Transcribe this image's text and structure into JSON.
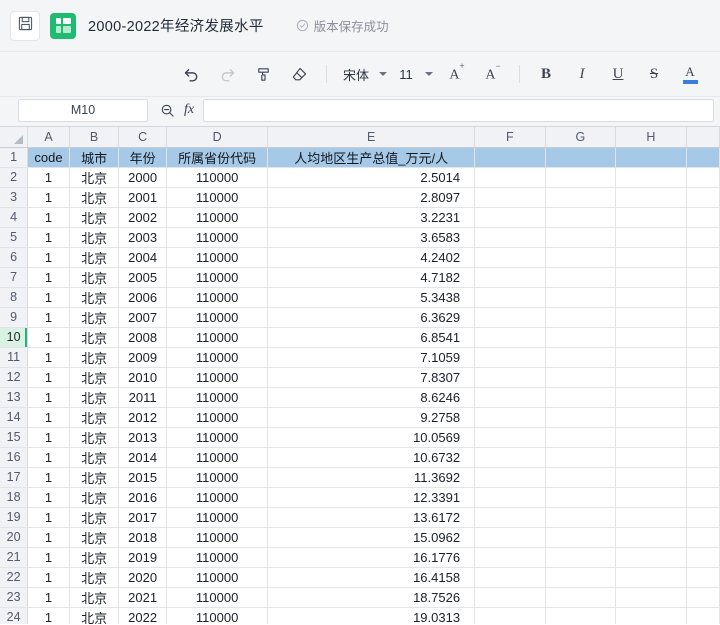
{
  "titlebar": {
    "save_icon": "floppy-disk-icon",
    "app_icon": "spreadsheet-app-icon",
    "doc_title": "2000-2022年经济发展水平",
    "save_status_icon": "check-circle-icon",
    "save_status": "版本保存成功"
  },
  "toolbar": {
    "undo": "↰",
    "redo": "↱",
    "format_painter": "format-painter-icon",
    "clear_format": "eraser-icon",
    "font_name": "宋体",
    "font_size": "11",
    "increase_font": "A",
    "increase_font_sup": "+",
    "decrease_font": "A",
    "decrease_font_sup": "−",
    "bold": "B",
    "italic": "I",
    "underline": "U",
    "strikethrough": "S",
    "font_color": "A",
    "font_color_hex": "#3b7ddd"
  },
  "formula_bar": {
    "name_box_value": "M10",
    "zoom_icon": "zoom-out-icon",
    "fx_label": "fx",
    "formula_value": "",
    "formula_placeholder": ""
  },
  "grid": {
    "column_headers": [
      "A",
      "B",
      "C",
      "D",
      "E",
      "F",
      "G",
      "H"
    ],
    "header_row_index": "1",
    "active_row": "10",
    "header_fill_hex": "#a6c9e8",
    "active_row_fill_hex": "#d9f2e4",
    "columns": [
      "code",
      "城市",
      "年份",
      "所属省份代码",
      "人均地区生产总值_万元/人"
    ],
    "rows": [
      {
        "n": "1",
        "a": "code",
        "b": "城市",
        "c": "年份",
        "d": "所属省份代码",
        "e": "人均地区生产总值_万元/人",
        "header": true
      },
      {
        "n": "2",
        "a": "1",
        "b": "北京",
        "c": "2000",
        "d": "110000",
        "e": "2.5014"
      },
      {
        "n": "3",
        "a": "1",
        "b": "北京",
        "c": "2001",
        "d": "110000",
        "e": "2.8097"
      },
      {
        "n": "4",
        "a": "1",
        "b": "北京",
        "c": "2002",
        "d": "110000",
        "e": "3.2231"
      },
      {
        "n": "5",
        "a": "1",
        "b": "北京",
        "c": "2003",
        "d": "110000",
        "e": "3.6583"
      },
      {
        "n": "6",
        "a": "1",
        "b": "北京",
        "c": "2004",
        "d": "110000",
        "e": "4.2402"
      },
      {
        "n": "7",
        "a": "1",
        "b": "北京",
        "c": "2005",
        "d": "110000",
        "e": "4.7182"
      },
      {
        "n": "8",
        "a": "1",
        "b": "北京",
        "c": "2006",
        "d": "110000",
        "e": "5.3438"
      },
      {
        "n": "9",
        "a": "1",
        "b": "北京",
        "c": "2007",
        "d": "110000",
        "e": "6.3629"
      },
      {
        "n": "10",
        "a": "1",
        "b": "北京",
        "c": "2008",
        "d": "110000",
        "e": "6.8541",
        "active": true
      },
      {
        "n": "11",
        "a": "1",
        "b": "北京",
        "c": "2009",
        "d": "110000",
        "e": "7.1059"
      },
      {
        "n": "12",
        "a": "1",
        "b": "北京",
        "c": "2010",
        "d": "110000",
        "e": "7.8307"
      },
      {
        "n": "13",
        "a": "1",
        "b": "北京",
        "c": "2011",
        "d": "110000",
        "e": "8.6246"
      },
      {
        "n": "14",
        "a": "1",
        "b": "北京",
        "c": "2012",
        "d": "110000",
        "e": "9.2758"
      },
      {
        "n": "15",
        "a": "1",
        "b": "北京",
        "c": "2013",
        "d": "110000",
        "e": "10.0569"
      },
      {
        "n": "16",
        "a": "1",
        "b": "北京",
        "c": "2014",
        "d": "110000",
        "e": "10.6732"
      },
      {
        "n": "17",
        "a": "1",
        "b": "北京",
        "c": "2015",
        "d": "110000",
        "e": "11.3692"
      },
      {
        "n": "18",
        "a": "1",
        "b": "北京",
        "c": "2016",
        "d": "110000",
        "e": "12.3391"
      },
      {
        "n": "19",
        "a": "1",
        "b": "北京",
        "c": "2017",
        "d": "110000",
        "e": "13.6172"
      },
      {
        "n": "20",
        "a": "1",
        "b": "北京",
        "c": "2018",
        "d": "110000",
        "e": "15.0962"
      },
      {
        "n": "21",
        "a": "1",
        "b": "北京",
        "c": "2019",
        "d": "110000",
        "e": "16.1776"
      },
      {
        "n": "22",
        "a": "1",
        "b": "北京",
        "c": "2020",
        "d": "110000",
        "e": "16.4158"
      },
      {
        "n": "23",
        "a": "1",
        "b": "北京",
        "c": "2021",
        "d": "110000",
        "e": "18.7526"
      },
      {
        "n": "24",
        "a": "1",
        "b": "北京",
        "c": "2022",
        "d": "110000",
        "e": "19.0313"
      }
    ]
  }
}
